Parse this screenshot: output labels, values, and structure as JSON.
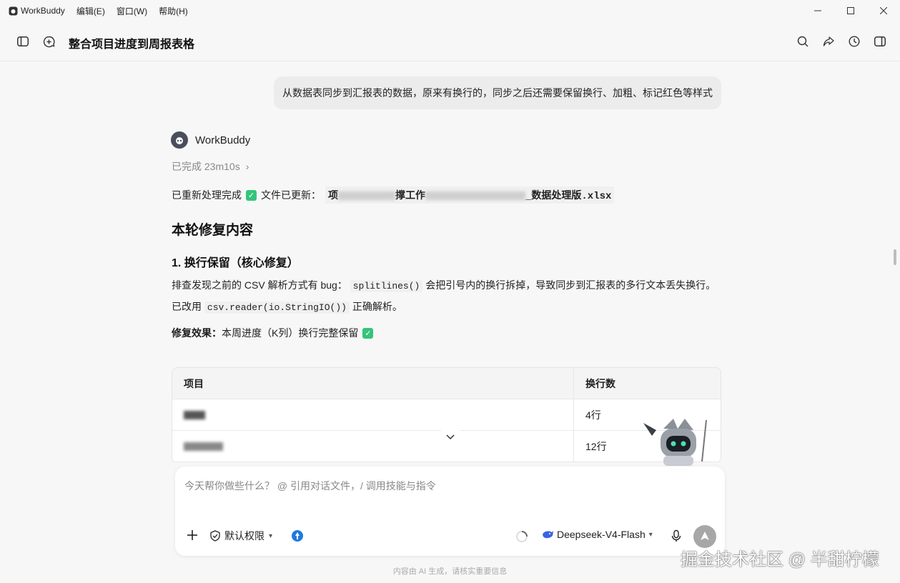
{
  "app": {
    "name": "WorkBuddy",
    "menu": [
      "编辑(E)",
      "窗口(W)",
      "帮助(H)"
    ]
  },
  "header": {
    "title": "整合项目进度到周报表格"
  },
  "chat": {
    "user_message": "从数据表同步到汇报表的数据，原来有换行的，同步之后还需要保留换行、加粗、标记红色等样式",
    "bot_name": "WorkBuddy",
    "status": "已完成 23m10s",
    "line1_prefix": "已重新处理完成",
    "line1_file_label": "文件已更新：",
    "file_name_start": "项",
    "file_name_mid": "撑工作",
    "file_name_end": "_数据处理版.xlsx",
    "heading": "本轮修复内容",
    "subheading": "1. 换行保留（核心修复）",
    "para_1": "排查发现之前的 CSV 解析方式有 bug：",
    "code_1": "splitlines()",
    "para_2": "会把引号内的换行拆掉，导致同步到汇报表的多行文本丢失换行。已改用",
    "code_2": "csv.reader(io.StringIO())",
    "para_3": "正确解析。",
    "effect_label": "修复效果：",
    "effect_text": "本周进度（K列）换行完整保留",
    "table": {
      "headers": [
        "项目",
        "换行数"
      ],
      "rows": [
        {
          "project": "",
          "count": "4行"
        },
        {
          "project": "",
          "count": "12行"
        }
      ]
    }
  },
  "input": {
    "placeholder": "今天帮你做些什么？ @ 引用对话文件，/ 调用技能与指令",
    "permission": "默认权限",
    "model": "Deepseek-V4-Flash"
  },
  "footer": {
    "disclaimer": "内容由 AI 生成，请核实重要信息"
  },
  "watermark": "掘金技术社区 @ 半甜柠檬",
  "colors": {
    "check": "#34c47c",
    "send": "#a7a7a7",
    "tool_blue": "#1f7ae0"
  }
}
